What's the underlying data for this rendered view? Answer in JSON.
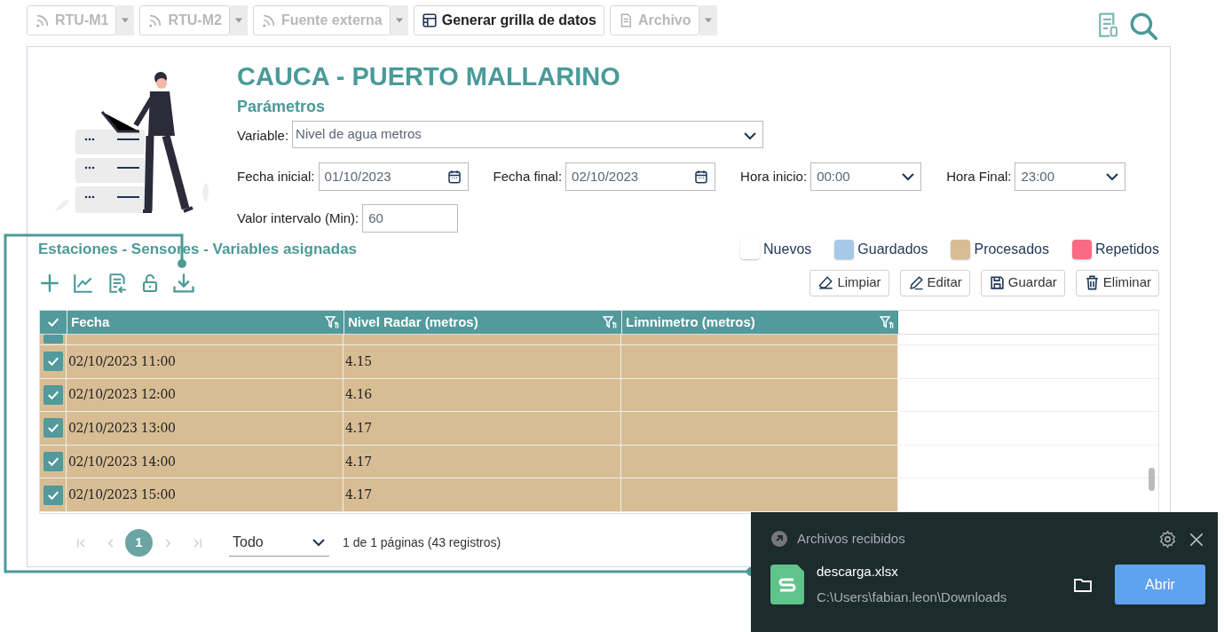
{
  "toolbar": [
    {
      "label": "RTU-M1",
      "kind": "feed-split",
      "disabled": true
    },
    {
      "label": "RTU-M2",
      "kind": "feed-split",
      "disabled": true
    },
    {
      "label": "Fuente externa",
      "kind": "feed-split",
      "disabled": true
    },
    {
      "label": "Generar grilla de datos",
      "kind": "grid-button",
      "disabled": false
    },
    {
      "label": "Archivo",
      "kind": "file-split",
      "disabled": true
    }
  ],
  "header": {
    "title": "CAUCA - PUERTO MALLARINO",
    "subtitle": "Parámetros"
  },
  "form": {
    "variable": {
      "label": "Variable:",
      "value": "Nivel de agua metros"
    },
    "fields": [
      {
        "label": "Fecha inicial:",
        "value": "01/10/2023",
        "kind": "date"
      },
      {
        "label": "Fecha final:",
        "value": "02/10/2023",
        "kind": "date"
      },
      {
        "label": "Hora inicio:",
        "value": "00:00",
        "kind": "select"
      },
      {
        "label": "Hora Final:",
        "value": "23:00",
        "kind": "select"
      }
    ],
    "interval": {
      "label": "Valor intervalo (Min):",
      "value": "60"
    }
  },
  "section_title": "Estaciones - Sensores - Variables asignadas",
  "legend": [
    {
      "label": "Nuevos",
      "color": "#ffffff"
    },
    {
      "label": "Guardados",
      "color": "#a8c8e8"
    },
    {
      "label": "Procesados",
      "color": "#d8bd94"
    },
    {
      "label": "Repetidos",
      "color": "#fb6a85"
    }
  ],
  "actions": [
    {
      "label": "Limpiar",
      "kind": "eraser"
    },
    {
      "label": "Editar",
      "kind": "pencil"
    },
    {
      "label": "Guardar",
      "kind": "save"
    },
    {
      "label": "Eliminar",
      "kind": "trash"
    }
  ],
  "table": {
    "columns": [
      "Fecha",
      "Nivel Radar (metros)",
      "Limnimetro (metros)"
    ],
    "rows": [
      {
        "partial": true,
        "checked": true,
        "cells": []
      },
      {
        "partial": false,
        "checked": true,
        "cells": [
          "02/10/2023 11:00",
          "4.15",
          ""
        ]
      },
      {
        "partial": false,
        "checked": true,
        "cells": [
          "02/10/2023 12:00",
          "4.16",
          ""
        ]
      },
      {
        "partial": false,
        "checked": true,
        "cells": [
          "02/10/2023 13:00",
          "4.17",
          ""
        ]
      },
      {
        "partial": false,
        "checked": true,
        "cells": [
          "02/10/2023 14:00",
          "4.17",
          ""
        ]
      },
      {
        "partial": false,
        "checked": true,
        "cells": [
          "02/10/2023 15:00",
          "4.17",
          ""
        ]
      }
    ]
  },
  "pagination": {
    "pages": [
      {
        "label": "1",
        "selected": true
      }
    ],
    "page_size": "Todo",
    "info": "1 de 1 páginas (43 registros)"
  },
  "download_toast": {
    "title": "Archivos recibidos",
    "file_name": "descarga.xlsx",
    "path": "C:\\Users\\fabian.leon\\Downloads",
    "button": "Abrir"
  }
}
